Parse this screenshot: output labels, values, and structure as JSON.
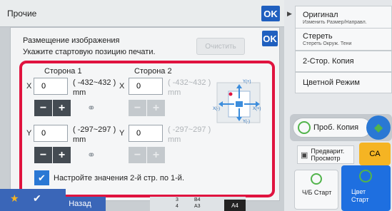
{
  "header": {
    "title": "Прочие",
    "ok_label": "OK"
  },
  "dialog": {
    "heading": "Размещение изображения",
    "instruction": "Укажите стартовую позицию печати.",
    "ok_label": "OK",
    "clear_label": "Очистить",
    "side1": {
      "label": "Сторона 1",
      "x_label": "X",
      "x_value": "0",
      "x_range": "( -432~432 )",
      "x_unit": "mm",
      "y_label": "Y",
      "y_value": "0",
      "y_range": "( -297~297 )",
      "y_unit": "mm"
    },
    "side2": {
      "label": "Сторона 2",
      "x_label": "X",
      "x_value": "0",
      "x_range": "( -432~432 )",
      "x_unit": "mm",
      "y_label": "Y",
      "y_value": "0",
      "y_range": "( -297~297 )",
      "y_unit": "mm"
    },
    "diagram": {
      "y_plus": "Y(+)",
      "y_minus": "Y(-)",
      "x_plus": "X(+)",
      "x_minus": "X(-)"
    },
    "checkbox_label": "Настройте значения 2-й стр. по 1-й.",
    "checkbox_checked": true
  },
  "bottom": {
    "back_label": "Назад",
    "tray_rows": [
      {
        "num": "3",
        "size": "B4"
      },
      {
        "num": "4",
        "size": "A3"
      }
    ],
    "paper_label": "A4"
  },
  "right_panel": {
    "items": [
      {
        "label": "Оригинал",
        "sub": "Изменить Размер/Направл."
      },
      {
        "label": "Стереть",
        "sub": "Стереть Окруж. Тени"
      },
      {
        "label": "2-Стор. Копия",
        "sub": ""
      },
      {
        "label": "Цветной Режим",
        "sub": ""
      }
    ],
    "preview_copy_label": "Проб. Копия",
    "preview_label": "Предварит. Просмотр",
    "ca_label": "CA",
    "bw_start_label": "Ч/Б Старт",
    "color_start_label": "Цвет Старт"
  },
  "colors": {
    "accent": "#1f5fbf",
    "highlight": "#e0133f",
    "start_color": "#1e6fe0",
    "green_icon": "#52b44b"
  }
}
